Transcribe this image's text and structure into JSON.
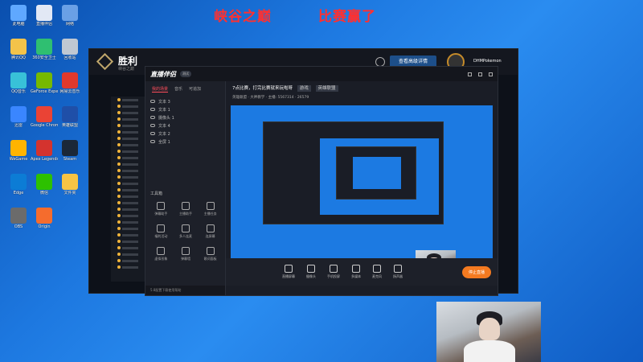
{
  "overlay": {
    "left_text": "峡谷之巅",
    "right_text": "比赛赢了"
  },
  "desktop_icons": [
    "此电脑",
    "直播伴侣",
    "网络",
    "腾讯QQ",
    "360安全卫士",
    "回收站",
    "QQ音乐",
    "GeForce Experience",
    "网易云音乐",
    "迅雷",
    "Google Chrome",
    "英雄联盟",
    "WeGame",
    "Apex Legends",
    "Steam",
    "Edge",
    "微信",
    "文件夹",
    "OBS",
    "Origin"
  ],
  "client": {
    "title": "胜利",
    "subtitle": "峡谷之巅",
    "record_label": "查看高级详情",
    "username": "DHMPokemon"
  },
  "streamer": {
    "logo": "直播伴侣",
    "badge": "测试",
    "tabs": [
      "我的场景",
      "音乐",
      "可追加"
    ],
    "sources": [
      "文本 3",
      "文本 1",
      "摄像头 1",
      "文本 4",
      "文本 2",
      "全屏 1"
    ],
    "tools_header": "工具箱",
    "tools": [
      "弹幕助手",
      "主播助手",
      "主播任务",
      "福利活动",
      "多人连麦",
      "连屏幕",
      "虚拟形象",
      "弹幕墙",
      "歌词面板"
    ],
    "title_line": "7点比赛，打完比赛就来玩啦呀",
    "title_tag": "游戏",
    "title_tag2": "英雄联盟",
    "info_line": "英雄联盟 · 大神教学 · 主播: 5567314 · 26579",
    "bottom_buttons": [
      "直播屏幕",
      "摄像头",
      "手机投屏",
      "多媒体",
      "麦克风",
      "扬声器"
    ],
    "go_live": "停止直播",
    "status": "5.8配置下载使用帮助"
  }
}
